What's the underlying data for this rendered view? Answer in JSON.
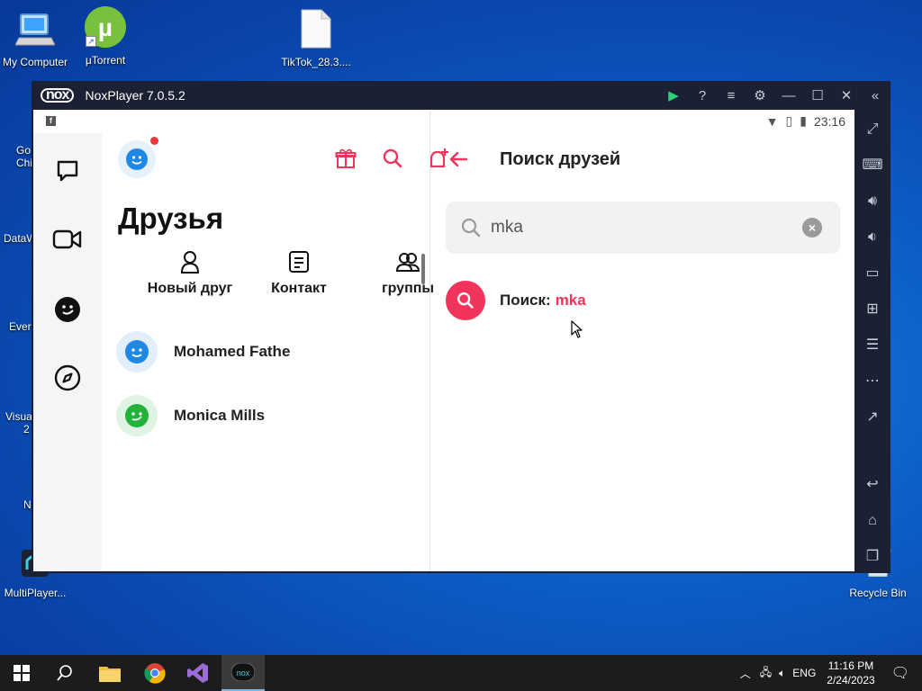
{
  "desktop": {
    "icons": [
      {
        "label": "My Computer"
      },
      {
        "label": "μTorrent"
      },
      {
        "label": "TikTok_28.3...."
      },
      {
        "label": "Recycle Bin"
      },
      {
        "label": "MultiPlayer..."
      }
    ],
    "partial_labels": [
      "Go",
      "Chi",
      "DataW",
      "Ever",
      "Visua",
      "2",
      "N"
    ]
  },
  "window": {
    "logo": "nox",
    "title": "NoxPlayer 7.0.5.2"
  },
  "status_bar": {
    "time": "23:16"
  },
  "left_panel": {
    "title": "Друзья",
    "quick_actions": [
      {
        "label": "Новый друг",
        "icon": "person-icon"
      },
      {
        "label": "Контакт",
        "icon": "contact-list-icon"
      },
      {
        "label": "группы",
        "icon": "group-icon"
      }
    ],
    "friends": [
      {
        "name": "Mohamed Fathe",
        "avatar_color": "#1e88e5",
        "avatar_bg": "#e3eefb"
      },
      {
        "name": "Monica Mills",
        "avatar_color": "#22b33a",
        "avatar_bg": "#dff4e2"
      }
    ]
  },
  "right_panel": {
    "title": "Поиск друзей",
    "search": {
      "value": "mka"
    },
    "result": {
      "prefix": "Поиск:",
      "query": "mka"
    }
  },
  "taskbar": {
    "lang": "ENG",
    "time": "11:16 PM",
    "date": "2/24/2023"
  },
  "colors": {
    "accent": "#f0345c",
    "brand_blue": "#1e88e5"
  }
}
